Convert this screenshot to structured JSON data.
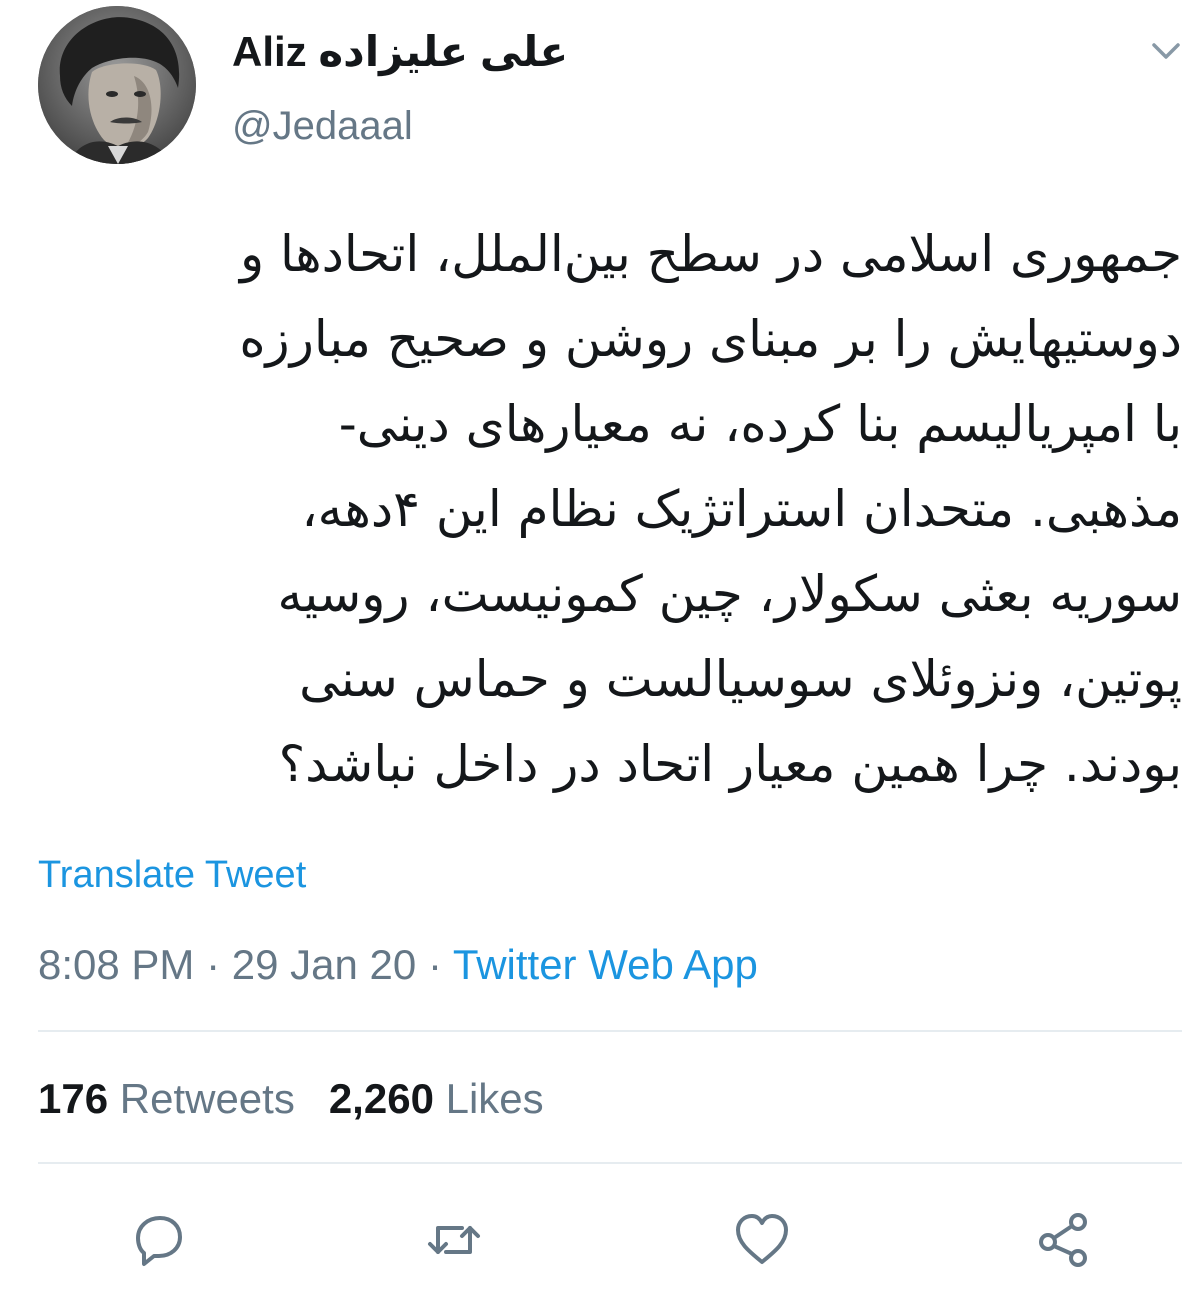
{
  "user": {
    "display_name_latin": "Aliz",
    "display_name_persian": "علی علیزاده",
    "handle": "@Jedaaal",
    "avatar_icon": "profile-photo"
  },
  "tweet": {
    "lines": [
      "جمهوری اسلامی در سطح بین‌الملل، اتحادها و",
      "دوستیهایش را بر مبنای روشن و صحیح مبارزه",
      "با امپریالیسم بنا کرده، نه معیارهای دینی-",
      "مذهبی. متحدان استراتژیک نظام این ۴دهه،",
      "سوریه بعثی سکولار، چین کمونیست، روسیه",
      "پوتین، ونزوئلای سوسیالست و حماس سنی",
      "بودند. چرا همین معیار اتحاد در داخل نباشد؟"
    ],
    "translate_label": "Translate Tweet",
    "time": "8:08 PM",
    "separator": "·",
    "date": "29 Jan 20",
    "source": "Twitter Web App"
  },
  "stats": {
    "retweets_count": "176",
    "retweets_label": "Retweets",
    "likes_count": "2,260",
    "likes_label": "Likes"
  },
  "actions": [
    {
      "icon": "reply-icon"
    },
    {
      "icon": "retweet-icon"
    },
    {
      "icon": "like-icon"
    },
    {
      "icon": "share-icon"
    }
  ],
  "colors": {
    "link": "#1b95e0",
    "secondary_text": "#657786",
    "primary_text": "#14171a",
    "divider": "#e6ecf0"
  }
}
